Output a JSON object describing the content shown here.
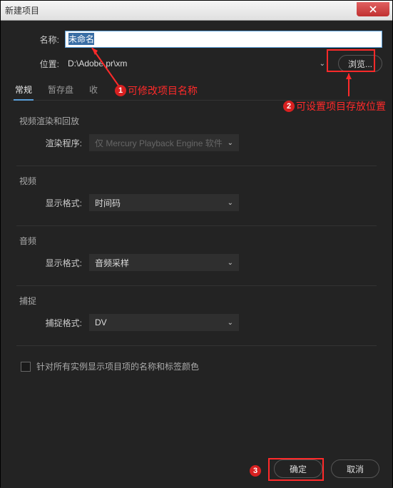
{
  "titlebar": {
    "title": "新建项目"
  },
  "form": {
    "name_label": "名称:",
    "name_value": "未命名",
    "location_label": "位置:",
    "location_value": "D:\\Adobe pr\\xm",
    "browse_label": "浏览..."
  },
  "tabs": {
    "general": "常规",
    "scratch": "暂存盘",
    "ingest_prefix": "收"
  },
  "sections": {
    "render": {
      "title": "视频渲染和回放",
      "renderer_label": "渲染程序:",
      "renderer_value": "仅 Mercury Playback Engine 软件"
    },
    "video": {
      "title": "视频",
      "format_label": "显示格式:",
      "format_value": "时间码"
    },
    "audio": {
      "title": "音频",
      "format_label": "显示格式:",
      "format_value": "音频采样"
    },
    "capture": {
      "title": "捕捉",
      "format_label": "捕捉格式:",
      "format_value": "DV"
    }
  },
  "checkbox": {
    "label": "针对所有实例显示项目项的名称和标签颜色"
  },
  "buttons": {
    "ok": "确定",
    "cancel": "取消"
  },
  "annotations": {
    "a1": "可修改项目名称",
    "a2": "可设置项目存放位置"
  }
}
